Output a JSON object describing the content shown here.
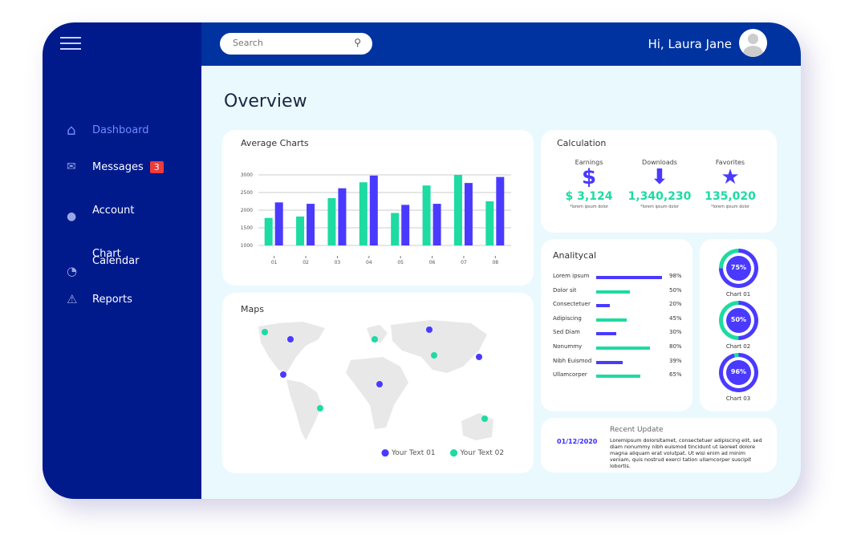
{
  "header": {
    "search_placeholder": "Search",
    "greeting": "Hi, Laura Jane"
  },
  "sidebar": {
    "items": [
      {
        "label": "Dashboard",
        "icon": "home-icon",
        "active": true
      },
      {
        "label": "Messages",
        "icon": "mail-icon",
        "badge": "3"
      },
      {
        "label": "Account",
        "icon": "user-icon"
      },
      {
        "label": "Chart",
        "icon": "pie-chart-icon"
      },
      {
        "label": "Calendar",
        "icon": ""
      },
      {
        "label": "Reports",
        "icon": "warning-icon"
      }
    ]
  },
  "page_title": "Overview",
  "colors": {
    "green": "#1ddba3",
    "blue": "#4a3aff",
    "sidebar": "#001a8c",
    "topbar": "#0033a0"
  },
  "average_charts": {
    "title": "Average Charts"
  },
  "chart_data": {
    "type": "bar",
    "categories": [
      "01",
      "02",
      "03",
      "04",
      "05",
      "06",
      "07",
      "08"
    ],
    "yticks": [
      "1000",
      "1500",
      "2000",
      "2500",
      "3000"
    ],
    "ylim": [
      1000,
      3000
    ],
    "series": [
      {
        "color": "#1ddba3",
        "values": [
          1780,
          1820,
          2340,
          2790,
          1920,
          2700,
          3000,
          2250
        ]
      },
      {
        "color": "#4a3aff",
        "values": [
          2220,
          2180,
          2620,
          2980,
          2150,
          2180,
          2770,
          2940
        ]
      }
    ]
  },
  "calculation": {
    "title": "Calculation",
    "items": [
      {
        "label": "Earnings",
        "icon": "dollar-icon",
        "value": "$ 3,124",
        "note": "*lorem ipsum dolor"
      },
      {
        "label": "Downloads",
        "icon": "arrow-down-icon",
        "value": "1,340,230",
        "note": "*lorem ipsum dolor"
      },
      {
        "label": "Favorites",
        "icon": "star-icon",
        "value": "135,020",
        "note": "*lorem ipsum dolor"
      }
    ]
  },
  "analytical": {
    "title": "Analitycal",
    "rows": [
      {
        "label": "Lorem ipsum",
        "value": 98,
        "text": "98%"
      },
      {
        "label": "Dolor sit",
        "value": 50,
        "text": "50%"
      },
      {
        "label": "Consectetuer",
        "value": 20,
        "text": "20%"
      },
      {
        "label": "Adipiscing",
        "value": 45,
        "text": "45%"
      },
      {
        "label": "Sed Diam",
        "value": 30,
        "text": "30%"
      },
      {
        "label": "Nonummy",
        "value": 80,
        "text": "80%"
      },
      {
        "label": "Nibh Euismod",
        "value": 39,
        "text": "39%"
      },
      {
        "label": "Ullamcorper",
        "value": 65,
        "text": "65%"
      }
    ]
  },
  "donuts": [
    {
      "label": "Chart 01",
      "value": 75,
      "text": "75%"
    },
    {
      "label": "Chart 02",
      "value": 50,
      "text": "50%"
    },
    {
      "label": "Chart 03",
      "value": 96,
      "text": "96%"
    }
  ],
  "maps": {
    "title": "Maps",
    "legend": [
      "Your Text 01",
      "Your Text 02"
    ]
  },
  "update": {
    "title": "Recent Update",
    "date": "01/12/2020",
    "text": "Loremipsum dolorsitamet, consectetuer adipiscing elit, sed diam nonummy nibh euismod tincidunt ut laoreet dolore magna aliquam erat volutpat. Ut wisi enim ad minim veniam, quis nostrud exerci tation ullamcorper suscipit lobortis."
  }
}
